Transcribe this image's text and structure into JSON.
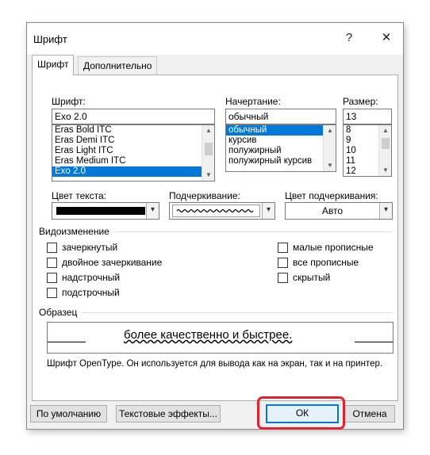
{
  "dialog": {
    "title": "Шрифт",
    "help_glyph": "?",
    "close_glyph": "✕"
  },
  "tabs": [
    {
      "label": "Шрифт",
      "active": true
    },
    {
      "label": "Дополнительно",
      "active": false
    }
  ],
  "font": {
    "label": "Шрифт:",
    "value": "Exo 2.0",
    "items": [
      "Eras Bold ITC",
      "Eras Demi ITC",
      "Eras Light ITC",
      "Eras Medium ITC",
      "Exo 2.0"
    ],
    "selected_index": 4
  },
  "style": {
    "label": "Начертание:",
    "value": "обычный",
    "items": [
      "обычный",
      "курсив",
      "полужирный",
      "полужирный курсив"
    ],
    "selected_index": 0
  },
  "size": {
    "label": "Размер:",
    "value": "13",
    "items": [
      "8",
      "9",
      "10",
      "11",
      "12"
    ]
  },
  "text_color": {
    "label": "Цвет текста:",
    "swatch": "#000000"
  },
  "underline": {
    "label": "Подчеркивание:"
  },
  "underline_color": {
    "label": "Цвет подчеркивания:",
    "value": "Авто"
  },
  "effects": {
    "legend": "Видоизменение",
    "left": [
      "зачеркнутый",
      "двойное зачеркивание",
      "надстрочный",
      "подстрочный"
    ],
    "right": [
      "малые прописные",
      "все прописные",
      "скрытый"
    ]
  },
  "preview": {
    "legend": "Образец",
    "text": "более качественно и быстрее.",
    "description": "Шрифт OpenType. Он используется для вывода как на экран, так и на принтер."
  },
  "buttons": {
    "default": "По умолчанию",
    "text_effects": "Текстовые эффекты...",
    "ok": "ОК",
    "cancel": "Отмена"
  },
  "colors": {
    "selection": "#0078d7",
    "highlight": "#e0222f",
    "dialog_bg": "#f0f0f0"
  },
  "icons": {
    "scroll_up": "▲",
    "scroll_down": "▼",
    "dropdown": "▾"
  }
}
